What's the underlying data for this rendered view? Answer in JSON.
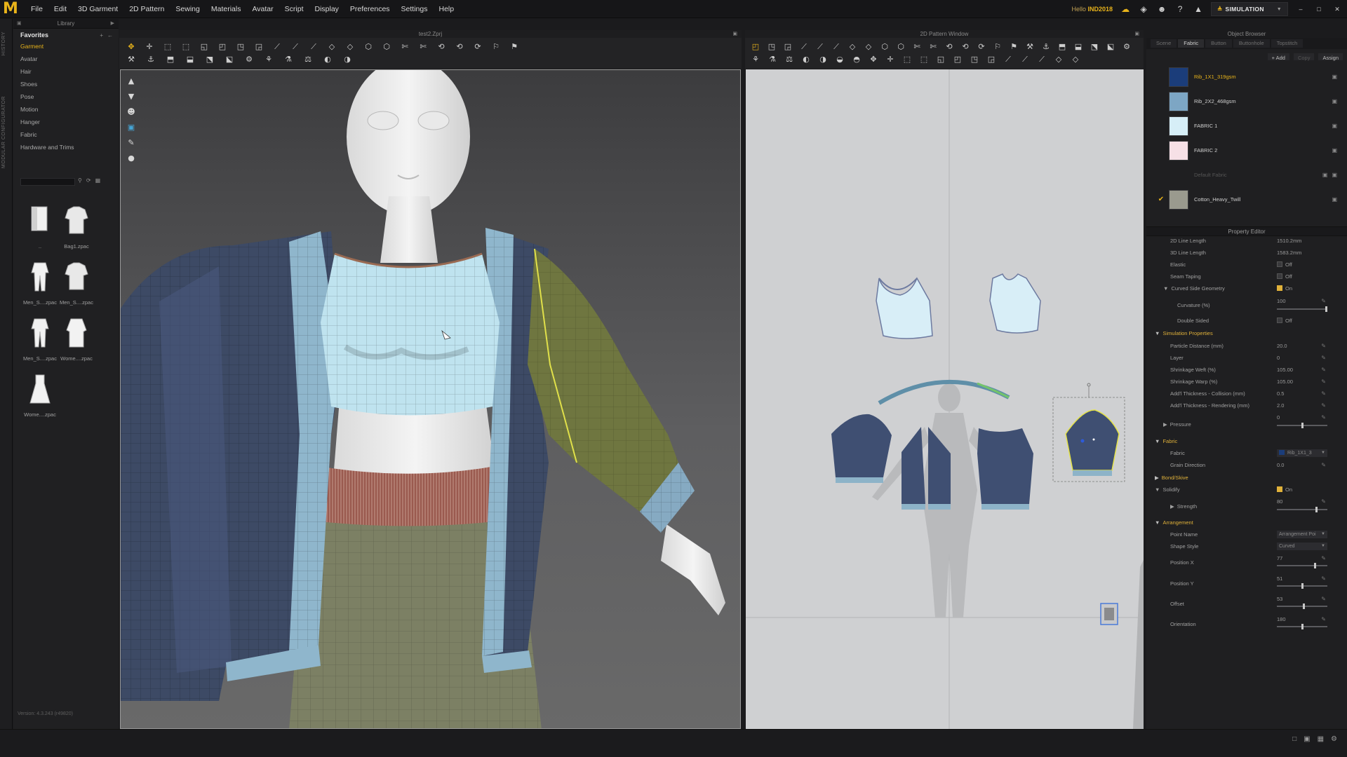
{
  "app": {
    "logo": "M"
  },
  "menu": [
    "File",
    "Edit",
    "3D Garment",
    "2D Pattern",
    "Sewing",
    "Materials",
    "Avatar",
    "Script",
    "Display",
    "Preferences",
    "Settings",
    "Help"
  ],
  "topbar": {
    "user_prefix": "Hello",
    "user_name": "IND2018",
    "mode_label": "SIMULATION"
  },
  "edge_strip": {
    "labels": [
      "HISTORY",
      "MODULAR CONFIGURATOR"
    ]
  },
  "library": {
    "title": "Library",
    "favorites_label": "Favorites",
    "items": [
      "Garment",
      "Avatar",
      "Hair",
      "Shoes",
      "Pose",
      "Motion",
      "Hanger",
      "Fabric",
      "Hardware and Trims"
    ],
    "active_item": "Garment",
    "thumbnails": [
      {
        "caption": "..",
        "icon": "folder-icon"
      },
      {
        "caption": "Bag1.zpac",
        "icon": "garment-shirt-icon"
      },
      {
        "caption": "Men_S....zpac",
        "icon": "garment-suit-icon"
      },
      {
        "caption": "Men_S....zpac",
        "icon": "garment-shirt-icon"
      },
      {
        "caption": "Men_S....zpac",
        "icon": "garment-suit-icon"
      },
      {
        "caption": "Wome....zpac",
        "icon": "garment-coat-icon"
      },
      {
        "caption": "Wome....zpac",
        "icon": "garment-dress-icon"
      }
    ]
  },
  "viewport3d": {
    "title": "test2.Zprj"
  },
  "pattern_window": {
    "title": "2D Pattern Window"
  },
  "object_browser": {
    "title": "Object Browser",
    "tabs": [
      "Scene",
      "Fabric",
      "Button",
      "Buttonhole",
      "Topstitch"
    ],
    "active_tab": "Fabric",
    "actions": [
      "+ Add",
      "Copy",
      "Assign"
    ],
    "fabrics": [
      {
        "name": "Rib_1X1_319gsm",
        "color": "#1b3d7a",
        "highlight": true,
        "checked": false,
        "dim": false
      },
      {
        "name": "Rib_2X2_468gsm",
        "color": "#7da6c4",
        "highlight": false,
        "checked": false,
        "dim": false
      },
      {
        "name": "FABRIC 1",
        "color": "#d6eef7",
        "highlight": false,
        "checked": false,
        "dim": false
      },
      {
        "name": "FABRIC 2",
        "color": "#f6e0e6",
        "highlight": false,
        "checked": false,
        "dim": false
      },
      {
        "name": "Default Fabric",
        "color": "#1f1f21",
        "highlight": false,
        "checked": false,
        "dim": true
      },
      {
        "name": "Cotton_Heavy_Twill",
        "color": "#9a9a8e",
        "highlight": false,
        "checked": true,
        "dim": false
      }
    ]
  },
  "property_editor": {
    "title": "Property Editor",
    "line_2d_label": "2D Line Length",
    "line_2d_value": "1510.2mm",
    "line_3d_label": "3D Line Length",
    "line_3d_value": "1583.2mm",
    "elastic_label": "Elastic",
    "elastic_value": "Off",
    "seam_taping_label": "Seam Taping",
    "seam_taping_value": "Off",
    "curved_label": "Curved Side Geometry",
    "curved_value": "On",
    "curvature_label": "Curvature (%)",
    "curvature_value": "100",
    "curvature_level": 1.0,
    "double_sided_label": "Double Sided",
    "double_sided_value": "Off",
    "sim_section": "Simulation Properties",
    "particle_label": "Particle Distance (mm)",
    "particle_value": "20.0",
    "layer_label": "Layer",
    "layer_value": "0",
    "weft_label": "Shrinkage Weft (%)",
    "weft_value": "105.00",
    "warp_label": "Shrinkage Warp (%)",
    "warp_value": "105.00",
    "collision_label": "Add'l Thickness - Collision (mm)",
    "collision_value": "0.5",
    "rendering_label": "Add'l Thickness - Rendering (mm)",
    "rendering_value": "2.0",
    "pressure_label": "Pressure",
    "pressure_value": "0",
    "pressure_level": 0.5,
    "fabric_section": "Fabric",
    "fabric_label": "Fabric",
    "fabric_value": "Rib_1X1_3",
    "grain_label": "Grain Direction",
    "grain_value": "0.0",
    "bond_section": "Bond/Skive",
    "solidify_label": "Solidify",
    "solidify_value": "On",
    "strength_label": "Strength",
    "strength_value": "80",
    "strength_level": 0.8,
    "arr_section": "Arrangement",
    "point_label": "Point Name",
    "point_value": "Arrangement Poi",
    "shape_label": "Shape Style",
    "shape_value": "Curved",
    "posx_label": "Position X",
    "posx_value": "77",
    "posx_level": 0.77,
    "posy_label": "Position Y",
    "posy_value": "51",
    "posy_level": 0.51,
    "offset_label": "Offset",
    "offset_value": "53",
    "offset_level": 0.53,
    "orient_label": "Orientation",
    "orient_value": "180",
    "orient_level": 0.5
  },
  "status": {
    "version": "Version: 4.3.243 (r49820)"
  }
}
